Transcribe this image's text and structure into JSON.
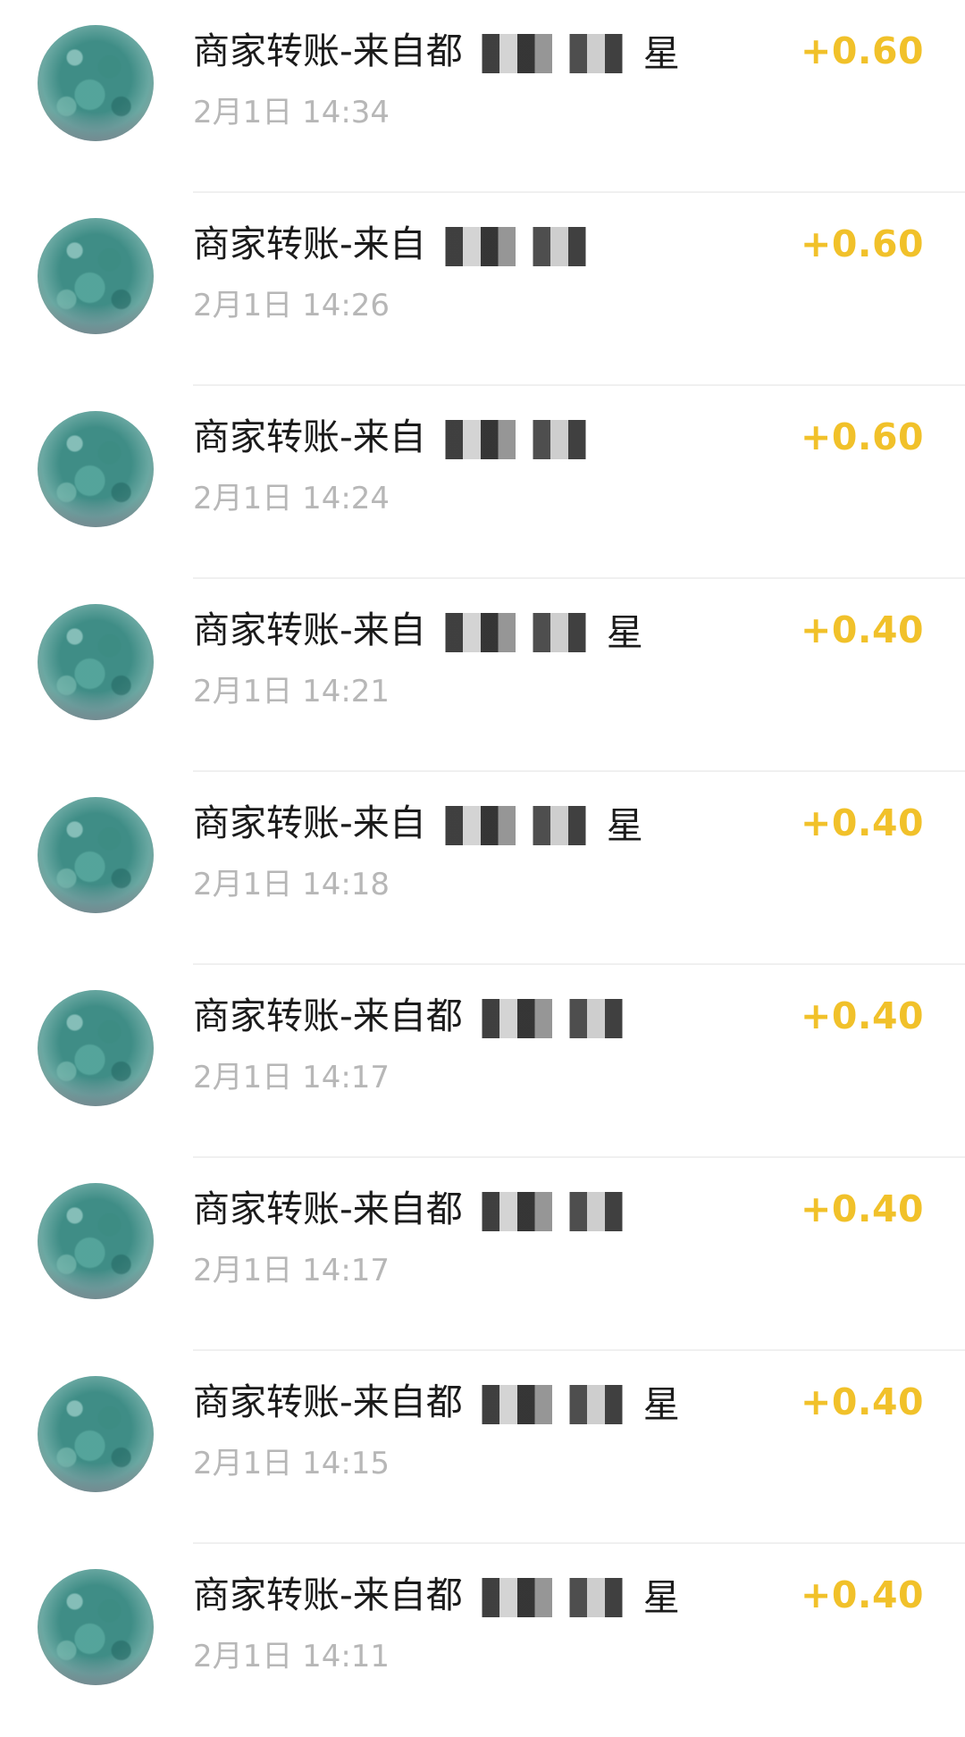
{
  "accent": {
    "amount_color": "#F1C12A",
    "time_color": "#B7B7B7"
  },
  "transactions": [
    {
      "title_prefix": "商家转账-来自都",
      "title_suffix": "星",
      "time": "2月1日 14:34",
      "amount": "+0.60",
      "avatar_icon": "plant-avatar-icon"
    },
    {
      "title_prefix": "商家转账-来自",
      "title_suffix": "",
      "time": "2月1日 14:26",
      "amount": "+0.60",
      "avatar_icon": "plant-avatar-icon"
    },
    {
      "title_prefix": "商家转账-来自",
      "title_suffix": "",
      "time": "2月1日 14:24",
      "amount": "+0.60",
      "avatar_icon": "plant-avatar-icon"
    },
    {
      "title_prefix": "商家转账-来自",
      "title_suffix": "星",
      "time": "2月1日 14:21",
      "amount": "+0.40",
      "avatar_icon": "plant-avatar-icon"
    },
    {
      "title_prefix": "商家转账-来自",
      "title_suffix": "星",
      "time": "2月1日 14:18",
      "amount": "+0.40",
      "avatar_icon": "plant-avatar-icon"
    },
    {
      "title_prefix": "商家转账-来自都",
      "title_suffix": "",
      "time": "2月1日 14:17",
      "amount": "+0.40",
      "avatar_icon": "plant-avatar-icon"
    },
    {
      "title_prefix": "商家转账-来自都",
      "title_suffix": "",
      "time": "2月1日 14:17",
      "amount": "+0.40",
      "avatar_icon": "plant-avatar-icon"
    },
    {
      "title_prefix": "商家转账-来自都",
      "title_suffix": "星",
      "time": "2月1日 14:15",
      "amount": "+0.40",
      "avatar_icon": "plant-avatar-icon"
    },
    {
      "title_prefix": "商家转账-来自都",
      "title_suffix": "星",
      "time": "2月1日 14:11",
      "amount": "+0.40",
      "avatar_icon": "plant-avatar-icon"
    }
  ]
}
